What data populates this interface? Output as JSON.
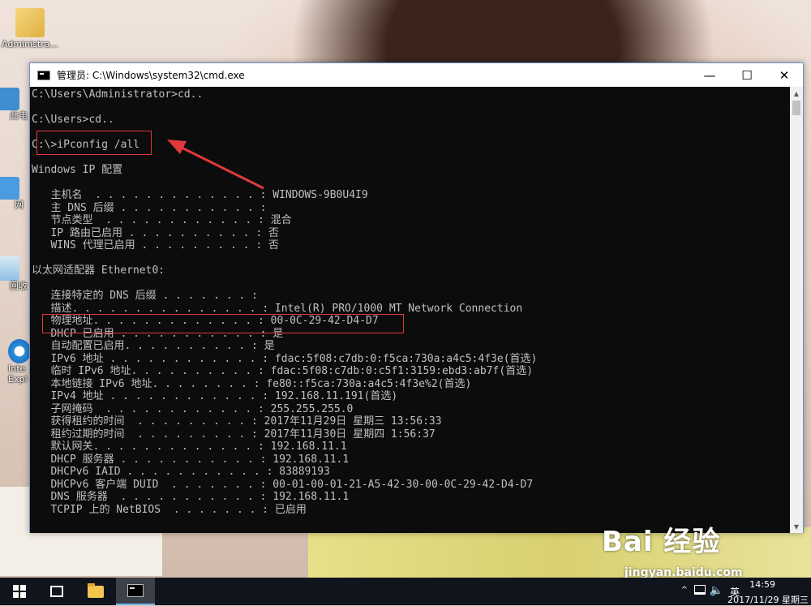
{
  "desktop": {
    "icons": [
      {
        "label": "Administra..."
      },
      {
        "label": "此电"
      },
      {
        "label": "网"
      },
      {
        "label": "回收"
      },
      {
        "label": "Inte Expl"
      }
    ]
  },
  "window": {
    "title": "管理员: C:\\Windows\\system32\\cmd.exe",
    "buttons": {
      "minimize": "—",
      "maximize": "☐",
      "close": "✕"
    }
  },
  "console": {
    "lines": [
      "C:\\Users\\Administrator>cd..",
      "",
      "C:\\Users>cd..",
      "",
      "C:\\>iPconfig /all",
      "",
      "Windows IP 配置",
      "",
      "   主机名  . . . . . . . . . . . . . : WINDOWS-9B0U4I9",
      "   主 DNS 后缀 . . . . . . . . . . . :",
      "   节点类型  . . . . . . . . . . . . : 混合",
      "   IP 路由已启用 . . . . . . . . . . : 否",
      "   WINS 代理已启用 . . . . . . . . . : 否",
      "",
      "以太网适配器 Ethernet0:",
      "",
      "   连接特定的 DNS 后缀 . . . . . . . :",
      "   描述. . . . . . . . . . . . . . . : Intel(R) PRO/1000 MT Network Connection",
      "   物理地址. . . . . . . . . . . . . : 00-0C-29-42-D4-D7",
      "   DHCP 已启用 . . . . . . . . . . . : 是",
      "   自动配置已启用. . . . . . . . . . : 是",
      "   IPv6 地址 . . . . . . . . . . . . : fdac:5f08:c7db:0:f5ca:730a:a4c5:4f3e(首选)",
      "   临时 IPv6 地址. . . . . . . . . . : fdac:5f08:c7db:0:c5f1:3159:ebd3:ab7f(首选)",
      "   本地链接 IPv6 地址. . . . . . . . : fe80::f5ca:730a:a4c5:4f3e%2(首选)",
      "   IPv4 地址 . . . . . . . . . . . . : 192.168.11.191(首选)",
      "   子网掩码  . . . . . . . . . . . . : 255.255.255.0",
      "   获得租约的时间  . . . . . . . . . : 2017年11月29日 星期三 13:56:33",
      "   租约过期的时间  . . . . . . . . . : 2017年11月30日 星期四 1:56:37",
      "   默认网关. . . . . . . . . . . . . : 192.168.11.1",
      "   DHCP 服务器 . . . . . . . . . . . : 192.168.11.1",
      "   DHCPv6 IAID . . . . . . . . . . . : 83889193",
      "   DHCPv6 客户端 DUID  . . . . . . . : 00-01-00-01-21-A5-42-30-00-0C-29-42-D4-D7",
      "   DNS 服务器  . . . . . . . . . . . : 192.168.11.1",
      "   TCPIP 上的 NetBIOS  . . . . . . . : 已启用"
    ]
  },
  "colors": {
    "console_bg": "#0c0c0c",
    "console_fg": "#c0c0c0",
    "annotation": "#e0393c",
    "taskbar": "#10141c"
  },
  "taskbar": {
    "items": [
      "start-icon",
      "task-view-icon",
      "file-explorer-icon",
      "cmd-icon"
    ],
    "tray": {
      "caret": "^",
      "ime": "英",
      "time": "14:59",
      "date": "2017/11/29 星期三"
    }
  },
  "watermark": {
    "logo": "Bai 经验",
    "sub": "jingyan.baidu.com"
  }
}
